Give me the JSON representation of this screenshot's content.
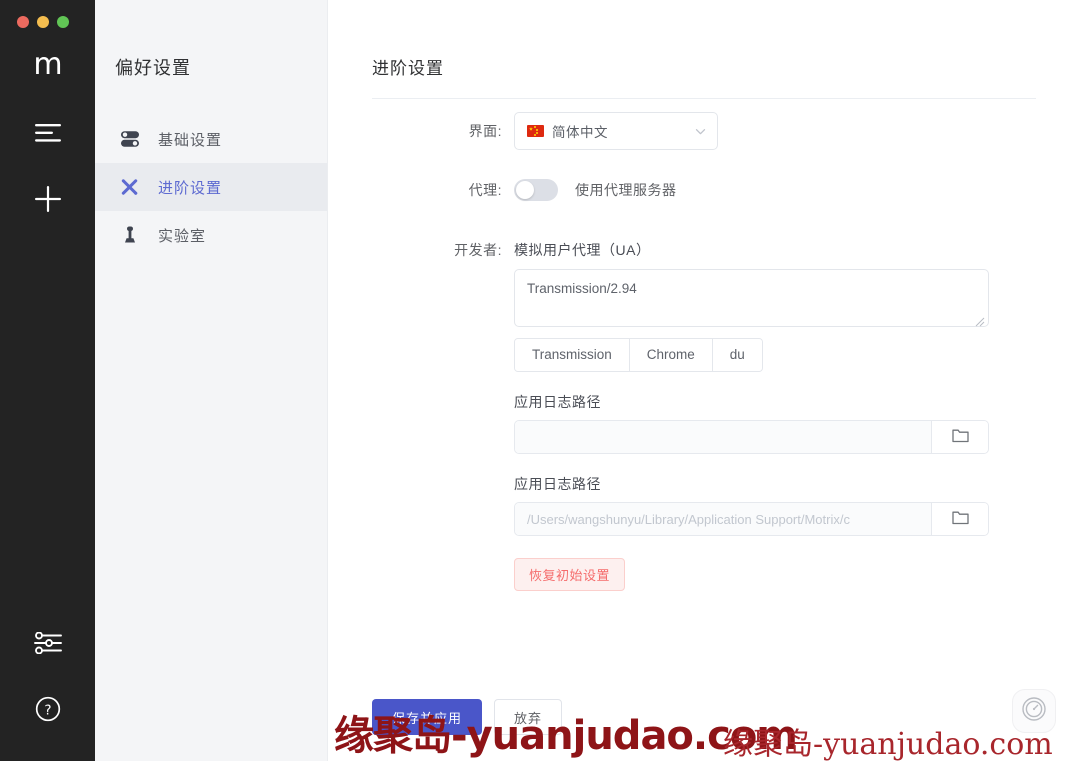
{
  "window": {
    "traffic_lights": [
      "close",
      "minimize",
      "zoom"
    ]
  },
  "rail": {
    "logo": "m",
    "items": [
      {
        "icon": "task-list-icon",
        "name": "tasks"
      },
      {
        "icon": "plus-icon",
        "name": "add-task"
      }
    ],
    "bottom_items": [
      {
        "icon": "sliders-icon",
        "name": "preferences"
      },
      {
        "icon": "help-circle-icon",
        "name": "help"
      }
    ]
  },
  "prefs": {
    "title": "偏好设置",
    "items": [
      {
        "label": "基础设置",
        "icon": "toggles-icon",
        "active": false
      },
      {
        "label": "进阶设置",
        "icon": "tools-icon",
        "active": true
      },
      {
        "label": "实验室",
        "icon": "flask-icon",
        "active": false
      }
    ]
  },
  "main": {
    "page_title": "进阶设置",
    "interface": {
      "label": "界面:",
      "selected": "简体中文",
      "flag": "cn-flag-icon",
      "chevron": "chevron-down-icon"
    },
    "proxy": {
      "label": "代理:",
      "toggle_state": "off",
      "description": "使用代理服务器"
    },
    "developer": {
      "label": "开发者:",
      "ua_title": "模拟用户代理（UA）",
      "ua_value": "Transmission/2.94",
      "presets": [
        "Transmission",
        "Chrome",
        "du"
      ]
    },
    "log_path_1": {
      "label": "应用日志路径",
      "value": "",
      "placeholder": "",
      "browse_icon": "folder-icon"
    },
    "log_path_2": {
      "label": "应用日志路径",
      "value": "",
      "placeholder": "/Users/wangshunyu/Library/Application Support/Motrix/c",
      "browse_icon": "folder-icon"
    },
    "reset_button": "恢复初始设置"
  },
  "footer": {
    "save_label": "保存并应用",
    "discard_label": "放弃",
    "speed_icon": "speedometer-icon"
  },
  "watermarks": [
    {
      "text": "缘聚岛-yuanjudao.com"
    },
    {
      "text": "缘聚岛-yuanjudao.com"
    }
  ],
  "colors": {
    "accent": "#4a56c9",
    "active_nav": "#5d6ad1",
    "danger": "#f56c6c",
    "rail_bg": "#232323",
    "panel_bg": "#f4f5f7"
  }
}
